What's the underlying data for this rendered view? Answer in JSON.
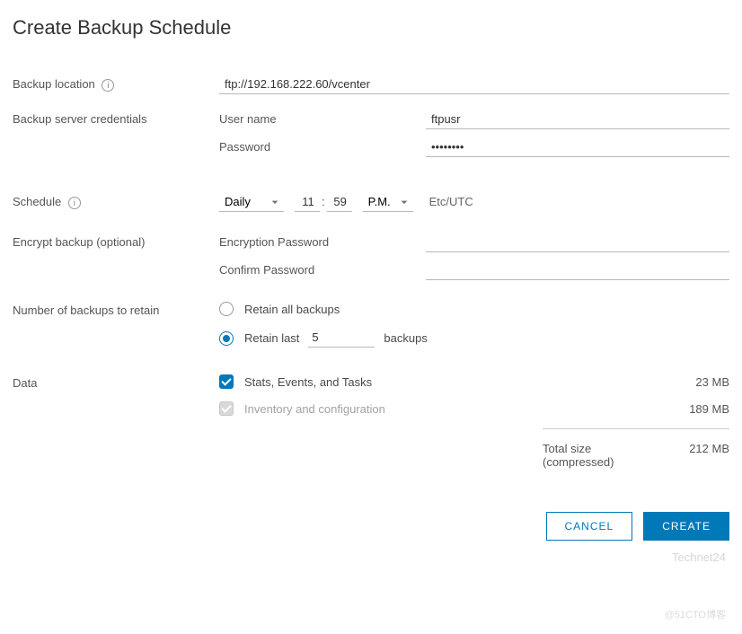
{
  "title": "Create Backup Schedule",
  "labels": {
    "backup_location": "Backup location",
    "credentials": "Backup server credentials",
    "username": "User name",
    "password": "Password",
    "schedule": "Schedule",
    "encrypt": "Encrypt backup (optional)",
    "enc_pass": "Encryption Password",
    "conf_pass": "Confirm Password",
    "retain": "Number of backups to retain",
    "retain_all": "Retain all backups",
    "retain_last_pre": "Retain last",
    "retain_last_post": "backups",
    "data": "Data",
    "stats": "Stats, Events, and Tasks",
    "inv": "Inventory and configuration",
    "total": "Total size (compressed)"
  },
  "values": {
    "location": "ftp://192.168.222.60/vcenter",
    "username": "ftpusr",
    "password": "••••••••",
    "freq": "Daily",
    "hour": "11",
    "minute": "59",
    "ampm": "P.M.",
    "tz": "Etc/UTC",
    "enc_pass": "",
    "conf_pass": "",
    "retain_mode": "last",
    "retain_count": "5",
    "stats_ck": true,
    "inv_ck": true
  },
  "sizes": {
    "stats": "23 MB",
    "inv": "189 MB",
    "total": "212 MB"
  },
  "buttons": {
    "cancel": "CANCEL",
    "create": "CREATE"
  },
  "marks": {
    "watermark": "Technet24",
    "blog": "@51CTO博客"
  },
  "info_glyph": "i",
  "colon": ":"
}
